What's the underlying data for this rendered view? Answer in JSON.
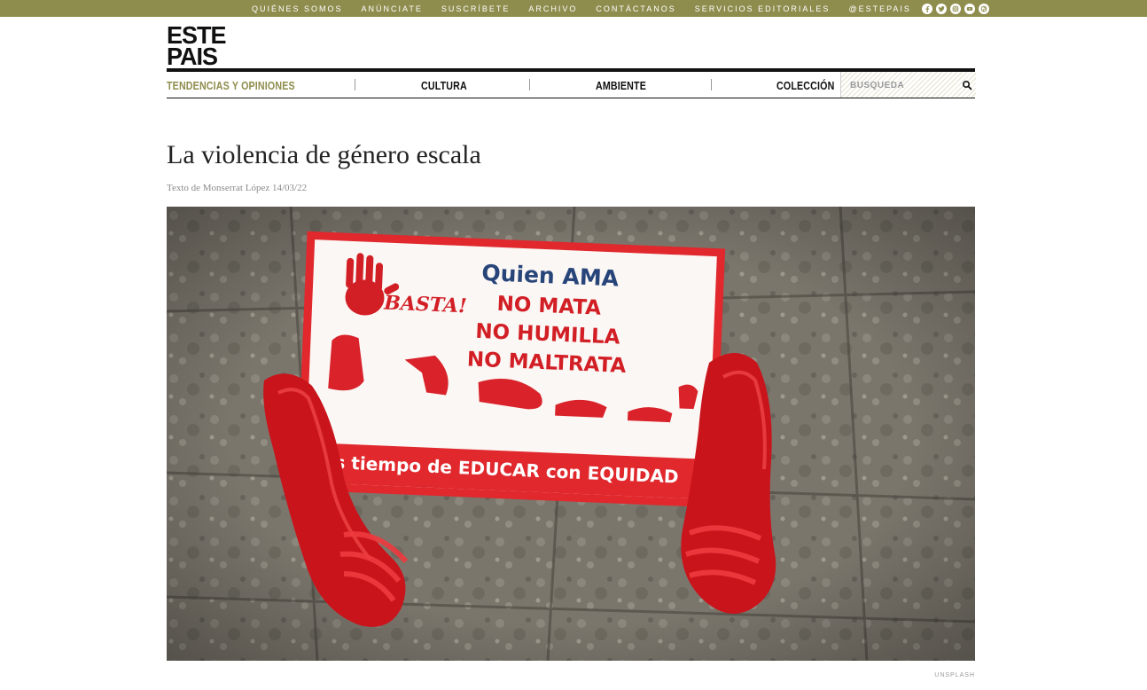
{
  "topbar": {
    "links": [
      "QUIÉNES SOMOS",
      "ANÚNCIATE",
      "SUSCRÍBETE",
      "ARCHIVO",
      "CONTÁCTANOS",
      "SERVICIOS EDITORIALES"
    ],
    "handle": "@ESTEPAIS",
    "social_icons": [
      "facebook-icon",
      "twitter-icon",
      "instagram-icon",
      "youtube-icon",
      "pinterest-icon"
    ],
    "bg_color": "#8f8d4e"
  },
  "logo": {
    "line1": "ESTE",
    "line2": "PAIS"
  },
  "nav": {
    "items": [
      "TENDENCIAS Y OPINIONES",
      "CULTURA",
      "AMBIENTE",
      "COLECCIÓN"
    ],
    "active_color": "#8f8d4e",
    "search_placeholder": "BÚSQUEDA"
  },
  "article": {
    "title": "La violencia de género escala",
    "byline": "Texto de Monserrat López 14/03/22",
    "image_credit": "UNSPLASH",
    "image": {
      "sign_lines": [
        "Quien AMA",
        "NO MATA",
        "NO HUMILLA",
        "NO MALTRATA"
      ],
      "sign_basta": "BASTA!",
      "sign_footer": "s tiempo de EDUCAR con EQUIDAD"
    }
  }
}
